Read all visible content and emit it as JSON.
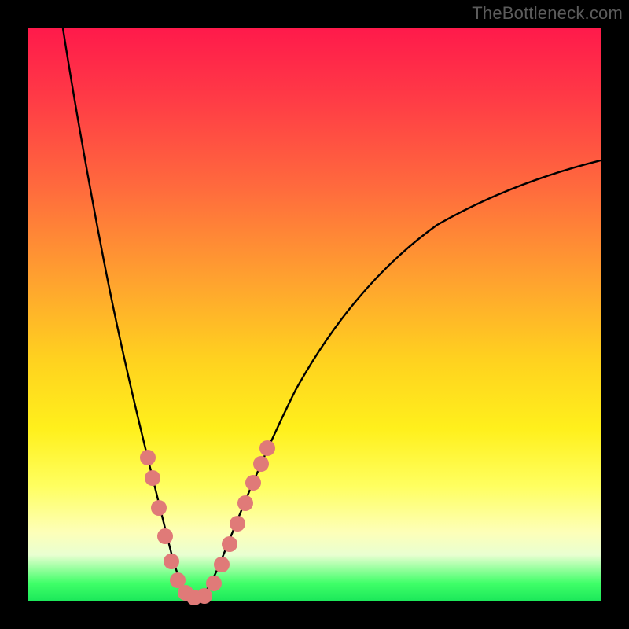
{
  "attribution": "TheBottleneck.com",
  "colors": {
    "frame": "#000000",
    "gradient_top": "#ff1a4b",
    "gradient_mid": "#ffd21f",
    "gradient_bottom": "#1ce85a",
    "curve": "#000000",
    "markers": "#e07a78"
  },
  "chart_data": {
    "type": "line",
    "title": "",
    "xlabel": "",
    "ylabel": "",
    "xlim": [
      0,
      100
    ],
    "ylim": [
      0,
      100
    ],
    "grid": false,
    "legend": false,
    "note": "V-shaped bottleneck curve. y≈100 at x≈6; drops to y≈0 at x≈29; rises back to y≈73 at x=100. Marker points highlight samples near the bottom of the curve on both branches.",
    "series": [
      {
        "name": "curve",
        "color": "#000000",
        "x": [
          6,
          8,
          10,
          12,
          14,
          16,
          18,
          20,
          22,
          24,
          25,
          26,
          27,
          28,
          29,
          30,
          31,
          32,
          33,
          34,
          36,
          38,
          40,
          44,
          48,
          52,
          56,
          60,
          66,
          72,
          80,
          90,
          100
        ],
        "y": [
          100,
          90,
          82,
          74,
          67,
          60,
          52,
          44,
          35,
          23,
          18,
          13,
          8,
          3,
          0,
          1,
          3,
          5,
          7,
          9,
          13,
          17,
          21,
          28,
          34,
          39,
          44,
          48,
          53,
          58,
          63,
          68,
          73
        ]
      },
      {
        "name": "markers",
        "color": "#e07a78",
        "x": [
          22,
          23,
          24,
          25,
          26,
          27,
          28,
          29,
          30,
          31,
          32,
          33,
          34,
          35,
          36,
          37,
          38,
          39
        ],
        "y": [
          35,
          31,
          23,
          18,
          13,
          8,
          3,
          0,
          1,
          3,
          5,
          7,
          9,
          11,
          13,
          15,
          17,
          22
        ]
      }
    ]
  }
}
